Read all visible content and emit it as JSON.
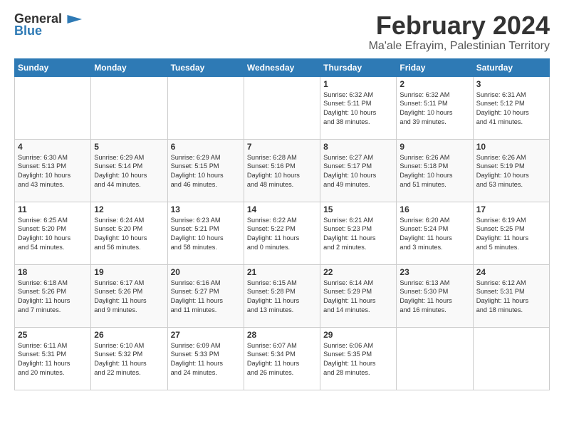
{
  "header": {
    "logo_general": "General",
    "logo_blue": "Blue",
    "month": "February 2024",
    "location": "Ma'ale Efrayim, Palestinian Territory"
  },
  "weekdays": [
    "Sunday",
    "Monday",
    "Tuesday",
    "Wednesday",
    "Thursday",
    "Friday",
    "Saturday"
  ],
  "weeks": [
    [
      {
        "day": "",
        "info": ""
      },
      {
        "day": "",
        "info": ""
      },
      {
        "day": "",
        "info": ""
      },
      {
        "day": "",
        "info": ""
      },
      {
        "day": "1",
        "info": "Sunrise: 6:32 AM\nSunset: 5:11 PM\nDaylight: 10 hours\nand 38 minutes."
      },
      {
        "day": "2",
        "info": "Sunrise: 6:32 AM\nSunset: 5:11 PM\nDaylight: 10 hours\nand 39 minutes."
      },
      {
        "day": "3",
        "info": "Sunrise: 6:31 AM\nSunset: 5:12 PM\nDaylight: 10 hours\nand 41 minutes."
      }
    ],
    [
      {
        "day": "4",
        "info": "Sunrise: 6:30 AM\nSunset: 5:13 PM\nDaylight: 10 hours\nand 43 minutes."
      },
      {
        "day": "5",
        "info": "Sunrise: 6:29 AM\nSunset: 5:14 PM\nDaylight: 10 hours\nand 44 minutes."
      },
      {
        "day": "6",
        "info": "Sunrise: 6:29 AM\nSunset: 5:15 PM\nDaylight: 10 hours\nand 46 minutes."
      },
      {
        "day": "7",
        "info": "Sunrise: 6:28 AM\nSunset: 5:16 PM\nDaylight: 10 hours\nand 48 minutes."
      },
      {
        "day": "8",
        "info": "Sunrise: 6:27 AM\nSunset: 5:17 PM\nDaylight: 10 hours\nand 49 minutes."
      },
      {
        "day": "9",
        "info": "Sunrise: 6:26 AM\nSunset: 5:18 PM\nDaylight: 10 hours\nand 51 minutes."
      },
      {
        "day": "10",
        "info": "Sunrise: 6:26 AM\nSunset: 5:19 PM\nDaylight: 10 hours\nand 53 minutes."
      }
    ],
    [
      {
        "day": "11",
        "info": "Sunrise: 6:25 AM\nSunset: 5:20 PM\nDaylight: 10 hours\nand 54 minutes."
      },
      {
        "day": "12",
        "info": "Sunrise: 6:24 AM\nSunset: 5:20 PM\nDaylight: 10 hours\nand 56 minutes."
      },
      {
        "day": "13",
        "info": "Sunrise: 6:23 AM\nSunset: 5:21 PM\nDaylight: 10 hours\nand 58 minutes."
      },
      {
        "day": "14",
        "info": "Sunrise: 6:22 AM\nSunset: 5:22 PM\nDaylight: 11 hours\nand 0 minutes."
      },
      {
        "day": "15",
        "info": "Sunrise: 6:21 AM\nSunset: 5:23 PM\nDaylight: 11 hours\nand 2 minutes."
      },
      {
        "day": "16",
        "info": "Sunrise: 6:20 AM\nSunset: 5:24 PM\nDaylight: 11 hours\nand 3 minutes."
      },
      {
        "day": "17",
        "info": "Sunrise: 6:19 AM\nSunset: 5:25 PM\nDaylight: 11 hours\nand 5 minutes."
      }
    ],
    [
      {
        "day": "18",
        "info": "Sunrise: 6:18 AM\nSunset: 5:26 PM\nDaylight: 11 hours\nand 7 minutes."
      },
      {
        "day": "19",
        "info": "Sunrise: 6:17 AM\nSunset: 5:26 PM\nDaylight: 11 hours\nand 9 minutes."
      },
      {
        "day": "20",
        "info": "Sunrise: 6:16 AM\nSunset: 5:27 PM\nDaylight: 11 hours\nand 11 minutes."
      },
      {
        "day": "21",
        "info": "Sunrise: 6:15 AM\nSunset: 5:28 PM\nDaylight: 11 hours\nand 13 minutes."
      },
      {
        "day": "22",
        "info": "Sunrise: 6:14 AM\nSunset: 5:29 PM\nDaylight: 11 hours\nand 14 minutes."
      },
      {
        "day": "23",
        "info": "Sunrise: 6:13 AM\nSunset: 5:30 PM\nDaylight: 11 hours\nand 16 minutes."
      },
      {
        "day": "24",
        "info": "Sunrise: 6:12 AM\nSunset: 5:31 PM\nDaylight: 11 hours\nand 18 minutes."
      }
    ],
    [
      {
        "day": "25",
        "info": "Sunrise: 6:11 AM\nSunset: 5:31 PM\nDaylight: 11 hours\nand 20 minutes."
      },
      {
        "day": "26",
        "info": "Sunrise: 6:10 AM\nSunset: 5:32 PM\nDaylight: 11 hours\nand 22 minutes."
      },
      {
        "day": "27",
        "info": "Sunrise: 6:09 AM\nSunset: 5:33 PM\nDaylight: 11 hours\nand 24 minutes."
      },
      {
        "day": "28",
        "info": "Sunrise: 6:07 AM\nSunset: 5:34 PM\nDaylight: 11 hours\nand 26 minutes."
      },
      {
        "day": "29",
        "info": "Sunrise: 6:06 AM\nSunset: 5:35 PM\nDaylight: 11 hours\nand 28 minutes."
      },
      {
        "day": "",
        "info": ""
      },
      {
        "day": "",
        "info": ""
      }
    ]
  ]
}
